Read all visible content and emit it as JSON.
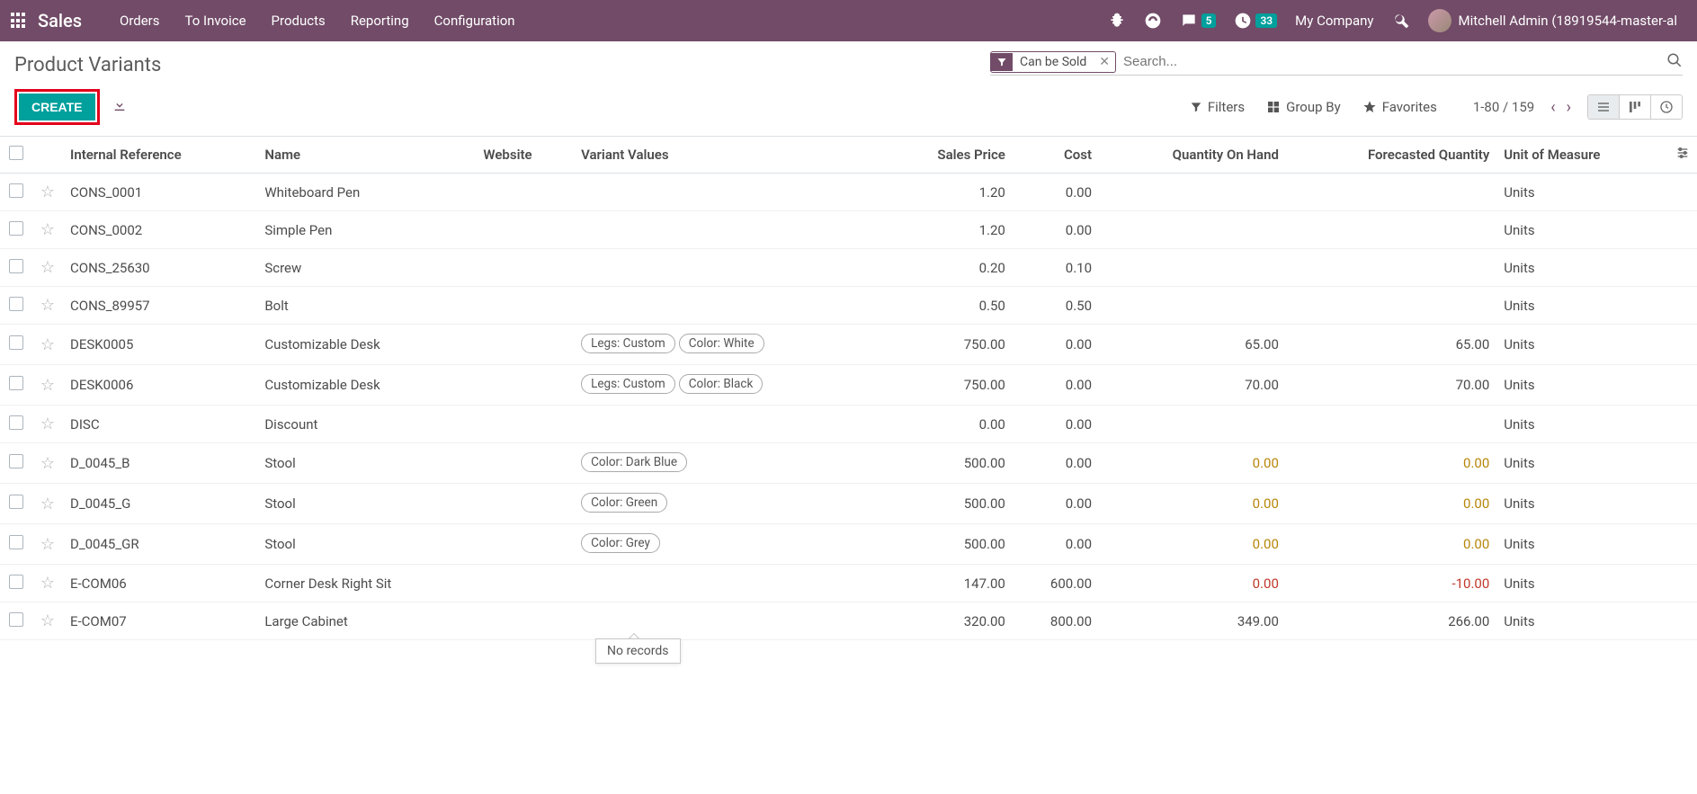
{
  "topnav": {
    "brand": "Sales",
    "menu": [
      "Orders",
      "To Invoice",
      "Products",
      "Reporting",
      "Configuration"
    ],
    "messaging_count": "5",
    "activity_count": "33",
    "company": "My Company",
    "user": "Mitchell Admin (18919544-master-al"
  },
  "cp": {
    "title": "Product Variants",
    "facet_label": "Can be Sold",
    "search_placeholder": "Search...",
    "create_label": "CREATE",
    "filters_label": "Filters",
    "groupby_label": "Group By",
    "favorites_label": "Favorites",
    "pager": "1-80 / 159"
  },
  "columns": {
    "internal_ref": "Internal Reference",
    "name": "Name",
    "website": "Website",
    "variant_values": "Variant Values",
    "sales_price": "Sales Price",
    "cost": "Cost",
    "qty_on_hand": "Quantity On Hand",
    "forecasted": "Forecasted Quantity",
    "uom": "Unit of Measure"
  },
  "rows": [
    {
      "ref": "CONS_0001",
      "name": "Whiteboard Pen",
      "variants": [],
      "price": "1.20",
      "cost": "0.00",
      "onhand": "",
      "onhand_cls": "",
      "forecast": "",
      "forecast_cls": "",
      "uom": "Units"
    },
    {
      "ref": "CONS_0002",
      "name": "Simple Pen",
      "variants": [],
      "price": "1.20",
      "cost": "0.00",
      "onhand": "",
      "onhand_cls": "",
      "forecast": "",
      "forecast_cls": "",
      "uom": "Units"
    },
    {
      "ref": "CONS_25630",
      "name": "Screw",
      "variants": [],
      "price": "0.20",
      "cost": "0.10",
      "onhand": "",
      "onhand_cls": "",
      "forecast": "",
      "forecast_cls": "",
      "uom": "Units"
    },
    {
      "ref": "CONS_89957",
      "name": "Bolt",
      "variants": [],
      "price": "0.50",
      "cost": "0.50",
      "onhand": "",
      "onhand_cls": "",
      "forecast": "",
      "forecast_cls": "",
      "uom": "Units"
    },
    {
      "ref": "DESK0005",
      "name": "Customizable Desk",
      "variants": [
        "Legs: Custom",
        "Color: White"
      ],
      "price": "750.00",
      "cost": "0.00",
      "onhand": "65.00",
      "onhand_cls": "",
      "forecast": "65.00",
      "forecast_cls": "",
      "uom": "Units"
    },
    {
      "ref": "DESK0006",
      "name": "Customizable Desk",
      "variants": [
        "Legs: Custom",
        "Color: Black"
      ],
      "price": "750.00",
      "cost": "0.00",
      "onhand": "70.00",
      "onhand_cls": "",
      "forecast": "70.00",
      "forecast_cls": "",
      "uom": "Units"
    },
    {
      "ref": "DISC",
      "name": "Discount",
      "variants": [],
      "price": "0.00",
      "cost": "0.00",
      "onhand": "",
      "onhand_cls": "",
      "forecast": "",
      "forecast_cls": "",
      "uom": "Units"
    },
    {
      "ref": "D_0045_B",
      "name": "Stool",
      "variants": [
        "Color: Dark Blue"
      ],
      "price": "500.00",
      "cost": "0.00",
      "onhand": "0.00",
      "onhand_cls": "warn",
      "forecast": "0.00",
      "forecast_cls": "warn",
      "uom": "Units"
    },
    {
      "ref": "D_0045_G",
      "name": "Stool",
      "variants": [
        "Color: Green"
      ],
      "price": "500.00",
      "cost": "0.00",
      "onhand": "0.00",
      "onhand_cls": "warn",
      "forecast": "0.00",
      "forecast_cls": "warn",
      "uom": "Units"
    },
    {
      "ref": "D_0045_GR",
      "name": "Stool",
      "variants": [
        "Color: Grey"
      ],
      "price": "500.00",
      "cost": "0.00",
      "onhand": "0.00",
      "onhand_cls": "warn",
      "forecast": "0.00",
      "forecast_cls": "warn",
      "uom": "Units"
    },
    {
      "ref": "E-COM06",
      "name": "Corner Desk Right Sit",
      "variants": [],
      "price": "147.00",
      "cost": "600.00",
      "onhand": "0.00",
      "onhand_cls": "neg",
      "forecast": "-10.00",
      "forecast_cls": "neg",
      "uom": "Units"
    },
    {
      "ref": "E-COM07",
      "name": "Large Cabinet",
      "variants": [],
      "price": "320.00",
      "cost": "800.00",
      "onhand": "349.00",
      "onhand_cls": "",
      "forecast": "266.00",
      "forecast_cls": "",
      "uom": "Units"
    }
  ],
  "tooltip": "No records"
}
